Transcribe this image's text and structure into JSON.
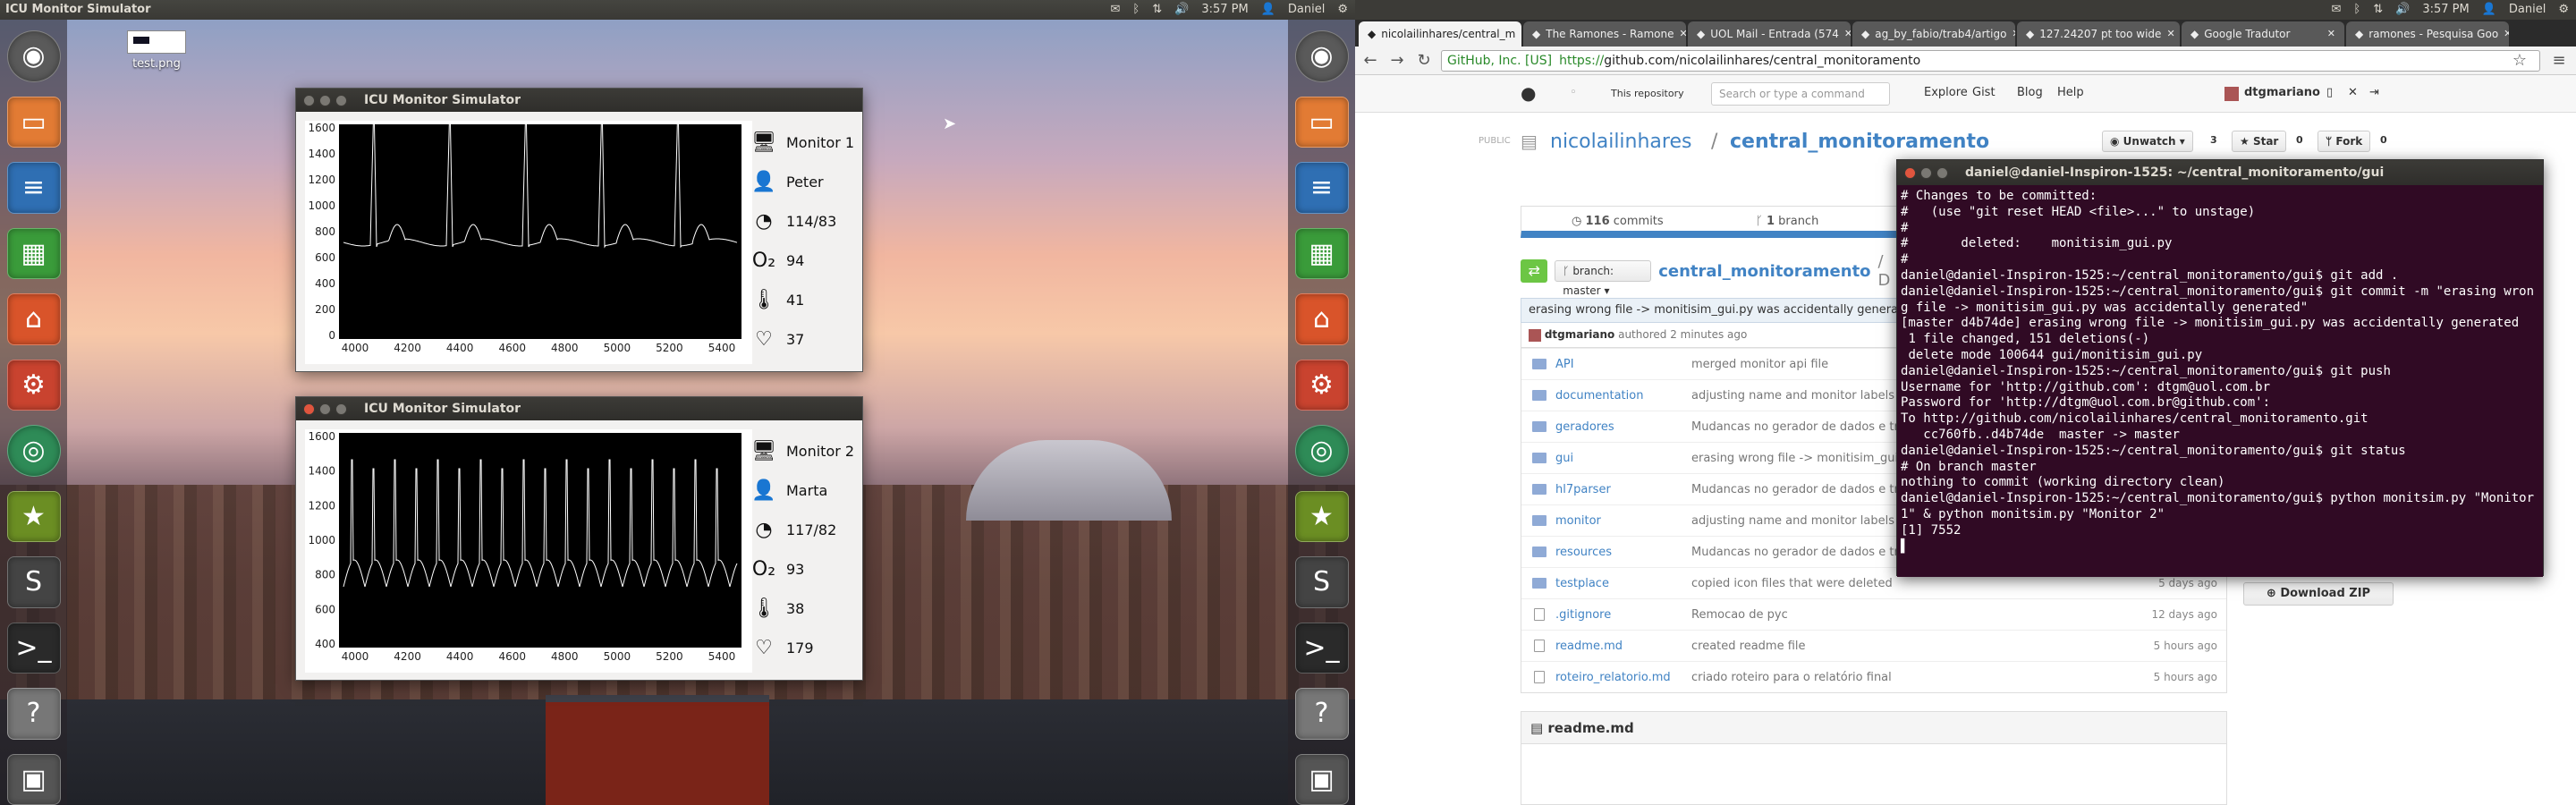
{
  "left_topbar": {
    "app_title": "ICU Monitor Simulator",
    "clock": "3:57 PM",
    "user": "Daniel"
  },
  "right_topbar": {
    "clock": "3:57 PM",
    "user": "Daniel"
  },
  "desktop_file": {
    "label": "test.png"
  },
  "launcher_icons": [
    "dash-home",
    "files",
    "libreoffice-writer",
    "libreoffice-calc",
    "software-center",
    "system-settings",
    "chrome",
    "game",
    "sublime-text",
    "terminal",
    "help",
    "workspaces"
  ],
  "monitors": [
    {
      "window_title": "ICU Monitor Simulator",
      "monitor": "Monitor 1",
      "patient": "Peter",
      "blood_pressure": "114/83",
      "o2": "94",
      "temperature": "41",
      "heart_rate": "37",
      "y_ticks": [
        "1600",
        "1400",
        "1200",
        "1000",
        "800",
        "600",
        "400",
        "200",
        "0"
      ],
      "x_ticks": [
        "4000",
        "4200",
        "4400",
        "4600",
        "4800",
        "5000",
        "5200",
        "5400"
      ]
    },
    {
      "window_title": "ICU Monitor Simulator",
      "monitor": "Monitor 2",
      "patient": "Marta",
      "blood_pressure": "117/82",
      "o2": "93",
      "temperature": "38",
      "heart_rate": "179",
      "y_ticks": [
        "1600",
        "1400",
        "1200",
        "1000",
        "800",
        "600",
        "400"
      ],
      "x_ticks": [
        "4000",
        "4200",
        "4400",
        "4600",
        "4800",
        "5000",
        "5200",
        "5400"
      ]
    }
  ],
  "browser": {
    "tabs": [
      {
        "label": "nicolailinhares/central_m",
        "icon": "github-icon"
      },
      {
        "label": "The Ramones - Ramone",
        "icon": "youtube-icon"
      },
      {
        "label": "UOL Mail - Entrada (574",
        "icon": "mail-icon"
      },
      {
        "label": "ag_by_fabio/trab4/artigo",
        "icon": "doc-icon"
      },
      {
        "label": "127.24207 pt too wide",
        "icon": "google-icon"
      },
      {
        "label": "Google Tradutor",
        "icon": "translate-icon"
      },
      {
        "label": "ramones - Pesquisa Goo",
        "icon": "google-icon"
      }
    ],
    "security_label": "GitHub, Inc. [US]",
    "url_scheme": "https://",
    "url_rest": "github.com/nicolailinhares/central_monitoramento"
  },
  "github": {
    "scope": "This repository",
    "search_placeholder": "Search or type a command",
    "nav": [
      "Explore",
      "Gist",
      "Blog",
      "Help"
    ],
    "username": "dtgmariano",
    "public_label": "PUBLIC",
    "owner": "nicolailinhares",
    "separator": "/",
    "repo": "central_monitoramento",
    "unwatch": "Unwatch",
    "unwatch_count": "3",
    "star": "Star",
    "star_count": "0",
    "fork": "Fork",
    "fork_count": "0",
    "commits_count": "116",
    "commits_label": "commits",
    "branch_count": "1",
    "branch_label": "branch",
    "branch_selector": "branch: master",
    "path_repo": "central_monitoramento",
    "path_sep": "/ D",
    "commit_message": "erasing wrong file -> monitisim_gui.py was accidentally generated",
    "commit_author": "dtgmariano",
    "commit_time": "authored 2 minutes ago",
    "files": [
      {
        "name": "API",
        "msg": "merged monitor api file",
        "age": "",
        "type": "dir"
      },
      {
        "name": "documentation",
        "msg": "adjusting name and monitor labels at m",
        "age": "",
        "type": "dir"
      },
      {
        "name": "geradores",
        "msg": "Mudancas no gerador de dados e troca",
        "age": "",
        "type": "dir"
      },
      {
        "name": "gui",
        "msg": "erasing wrong file -> monitisim_gui.py",
        "age": "",
        "type": "dir"
      },
      {
        "name": "hl7parser",
        "msg": "Mudancas no gerador de dados e troca",
        "age": "",
        "type": "dir"
      },
      {
        "name": "monitor",
        "msg": "adjusting name and monitor labels at m",
        "age": "",
        "type": "dir"
      },
      {
        "name": "resources",
        "msg": "Mudancas no gerador de dados e troca",
        "age": "",
        "type": "dir"
      },
      {
        "name": "testplace",
        "msg": "copied icon files that were deleted",
        "age": "5 days ago",
        "type": "dir"
      },
      {
        "name": ".gitignore",
        "msg": "Remocao de pyc",
        "age": "12 days ago",
        "type": "file"
      },
      {
        "name": "readme.md",
        "msg": "created readme file",
        "age": "5 hours ago",
        "type": "file"
      },
      {
        "name": "roteiro_relatorio.md",
        "msg": "criado roteiro para o relatório final",
        "age": "5 hours ago",
        "type": "file"
      }
    ],
    "download_zip": "Download ZIP",
    "readme_title": "readme.md"
  },
  "terminal": {
    "title": "daniel@daniel-Inspiron-1525: ~/central_monitoramento/gui",
    "output": "# Changes to be committed:\n#   (use \"git reset HEAD <file>...\" to unstage)\n#\n#       deleted:    monitisim_gui.py\n#\ndaniel@daniel-Inspiron-1525:~/central_monitoramento/gui$ git add .\ndaniel@daniel-Inspiron-1525:~/central_monitoramento/gui$ git commit -m \"erasing wrong file -> monitisim_gui.py was accidentally generated\"\n[master d4b74de] erasing wrong file -> monitisim_gui.py was accidentally generated\n 1 file changed, 151 deletions(-)\n delete mode 100644 gui/monitisim_gui.py\ndaniel@daniel-Inspiron-1525:~/central_monitoramento/gui$ git push\nUsername for 'http://github.com': dtgm@uol.com.br\nPassword for 'http://dtgm@uol.com.br@github.com':\nTo http://github.com/nicolailinhares/central_monitoramento.git\n   cc760fb..d4b74de  master -> master\ndaniel@daniel-Inspiron-1525:~/central_monitoramento/gui$ git status\n# On branch master\nnothing to commit (working directory clean)\ndaniel@daniel-Inspiron-1525:~/central_monitoramento/gui$ python monitsim.py \"Monitor 1\" & python monitsim.py \"Monitor 2\"\n[1] 7552\n▌"
  }
}
